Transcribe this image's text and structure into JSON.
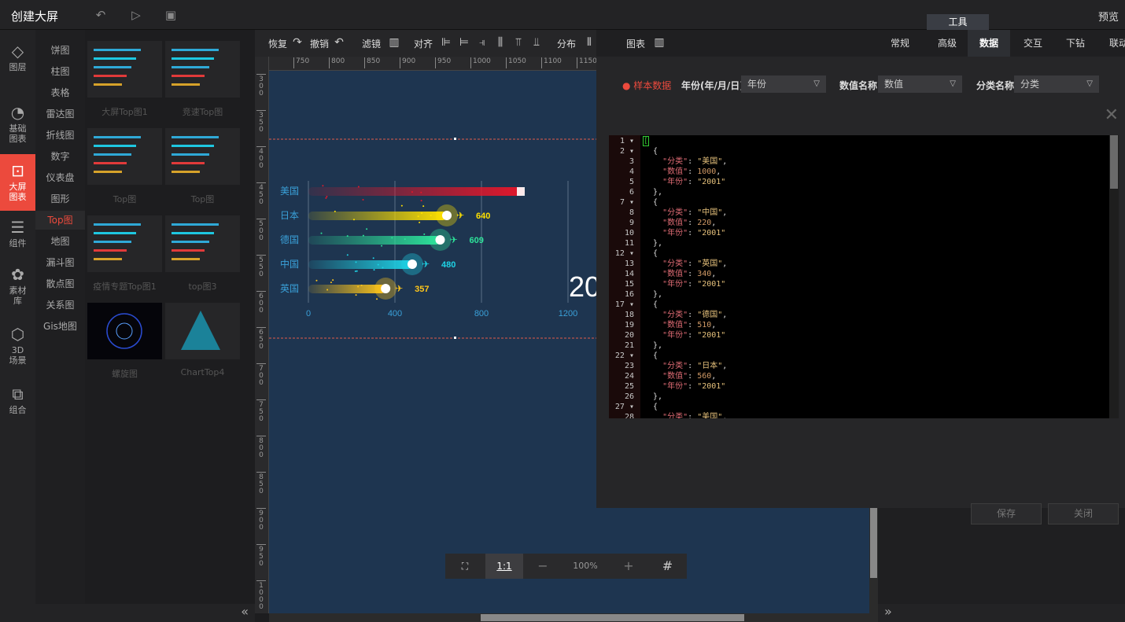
{
  "header": {
    "title": "创建大屏",
    "preview": "预览",
    "tools_tab": "工具"
  },
  "leftnav": [
    {
      "label": "图层",
      "icon": "layers-icon"
    },
    {
      "label": "基础\n图表",
      "icon": "pie-chart-icon"
    },
    {
      "label": "大屏\n图表",
      "icon": "screen-chart-icon",
      "active": true
    },
    {
      "label": "组件",
      "icon": "sliders-icon"
    },
    {
      "label": "素材\n库",
      "icon": "material-icon"
    },
    {
      "label": "3D\n场景",
      "icon": "cube-icon"
    },
    {
      "label": "组合",
      "icon": "group-icon"
    }
  ],
  "categories": [
    "饼图",
    "柱图",
    "表格",
    "雷达图",
    "折线图",
    "数字",
    "仪表盘",
    "图形",
    "Top图",
    "地图",
    "漏斗图",
    "散点图",
    "关系图",
    "Gis地图"
  ],
  "active_category": "Top图",
  "thumbnails": [
    "大屏Top图1",
    "竞速Top图",
    "Top图",
    "Top图",
    "疫情专题Top图1",
    "top图3",
    "螺旋图",
    "ChartTop4"
  ],
  "toolbar": {
    "restore": "恢复",
    "undo": "撤销",
    "filter": "滤镜",
    "align": "对齐",
    "distribute": "分布",
    "chart": "图表"
  },
  "ruler_top": [
    "750",
    "800",
    "850",
    "900",
    "950",
    "1000",
    "1050",
    "1100",
    "1150"
  ],
  "ruler_left": [
    "300",
    "350",
    "400",
    "450",
    "500",
    "550",
    "600",
    "650",
    "700",
    "750",
    "800",
    "850",
    "900",
    "950",
    "1000"
  ],
  "chart_data": {
    "type": "bar",
    "categories": [
      "美国",
      "日本",
      "德国",
      "中国",
      "英国"
    ],
    "values": [
      1000,
      640,
      609,
      480,
      357
    ],
    "xticks": [
      "0",
      "400",
      "800",
      "1200"
    ],
    "xlim": [
      0,
      1200
    ],
    "year_text": "20",
    "colors": [
      "#e3172b",
      "#ffe100",
      "#2de39a",
      "#1ed2e5",
      "#ffc61a"
    ]
  },
  "zoombar": {
    "ratio": "1:1",
    "minus": "−",
    "zoom": "100%",
    "plus": "+"
  },
  "tabs": [
    "常规",
    "高级",
    "数据",
    "交互",
    "下钻",
    "联动"
  ],
  "active_tab": "数据",
  "data_panel": {
    "sample_label": "● 样本数据",
    "year_label": "年份(年/月/日)",
    "year_value": "年份",
    "value_label": "数值名称",
    "value_value": "数值",
    "cat_label": "分类名称",
    "cat_value": "分类",
    "save": "保存",
    "close": "关闭"
  },
  "code_lines": [
    "[",
    "  {",
    "    \"分类\": \"美国\",",
    "    \"数值\": 1000,",
    "    \"年份\": \"2001\"",
    "  },",
    "  {",
    "    \"分类\": \"中国\",",
    "    \"数值\": 220,",
    "    \"年份\": \"2001\"",
    "  },",
    "  {",
    "    \"分类\": \"英国\",",
    "    \"数值\": 340,",
    "    \"年份\": \"2001\"",
    "  },",
    "  {",
    "    \"分类\": \"德国\",",
    "    \"数值\": 510,",
    "    \"年份\": \"2001\"",
    "  },",
    "  {",
    "    \"分类\": \"日本\",",
    "    \"数值\": 560,",
    "    \"年份\": \"2001\"",
    "  },",
    "  {",
    "    \"分类\": \"美国\","
  ]
}
